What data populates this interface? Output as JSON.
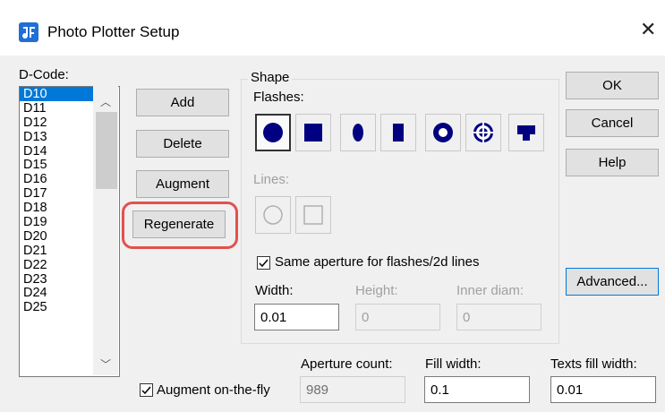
{
  "window": {
    "title": "Photo Plotter Setup",
    "close_glyph": "✕"
  },
  "dcode": {
    "label": "D-Code:",
    "items": [
      "D10",
      "D11",
      "D12",
      "D13",
      "D14",
      "D15",
      "D16",
      "D17",
      "D18",
      "D19",
      "D20",
      "D21",
      "D22",
      "D23",
      "D24",
      "D25"
    ],
    "selected": "D10"
  },
  "buttons": {
    "add": "Add",
    "delete": "Delete",
    "augment": "Augment",
    "regenerate": "Regenerate",
    "ok": "OK",
    "cancel": "Cancel",
    "help": "Help",
    "advanced": "Advanced..."
  },
  "shape": {
    "group_title": "Shape",
    "flashes_label": "Flashes:",
    "flash_icons": [
      "round-flash-icon",
      "square-flash-icon",
      "oval-flash-icon",
      "rectangle-flash-icon",
      "donut-flash-icon",
      "thermal-flash-icon",
      "custom-flash-icon"
    ],
    "lines_label": "Lines:",
    "line_icons": [
      "round-line-icon",
      "square-line-icon"
    ],
    "same_aperture_label": "Same aperture for flashes/2d lines",
    "same_aperture_checked": true,
    "width_label": "Width:",
    "width_value": "0.01",
    "height_label": "Height:",
    "height_value": "0",
    "inner_diam_label": "Inner diam:",
    "inner_diam_value": "0"
  },
  "footer": {
    "augment_fly_label": "Augment on-the-fly",
    "augment_fly_checked": true,
    "aperture_count_label": "Aperture count:",
    "aperture_count_value": "989",
    "fill_width_label": "Fill width:",
    "fill_width_value": "0.1",
    "texts_fill_width_label": "Texts fill width:",
    "texts_fill_width_value": "0.01"
  },
  "colors": {
    "accent": "#0078d7",
    "shape_fill": "#000080",
    "highlight": "#e0524e"
  }
}
